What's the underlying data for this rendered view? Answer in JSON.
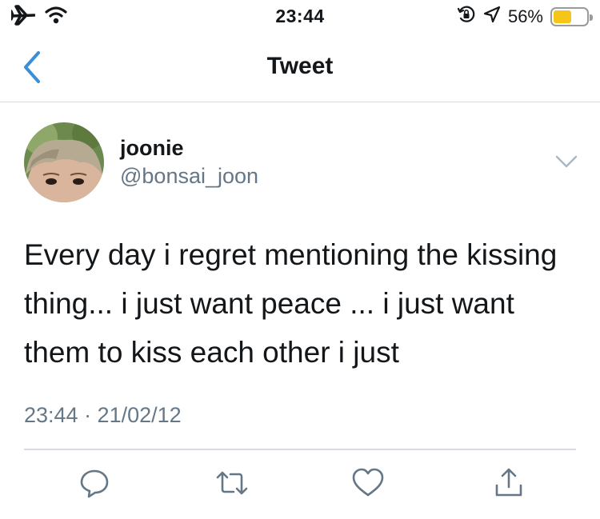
{
  "status_bar": {
    "time": "23:44",
    "battery_percent": "56%",
    "battery_level": 0.56,
    "battery_color": "#f5c518",
    "icons": [
      "airplane-icon",
      "wifi-icon",
      "orientation-lock-icon",
      "location-icon",
      "battery-icon"
    ]
  },
  "nav": {
    "title": "Tweet",
    "back_icon": "chevron-left-icon",
    "accent_color": "#3a8fd8"
  },
  "tweet": {
    "display_name": "joonie",
    "handle": "@bonsai_joon",
    "text": "Every day i regret mentioning the kissing thing... i just want peace ... i just want them to kiss each other i just",
    "timestamp": "23:44 · 21/02/12",
    "actions": [
      "reply-icon",
      "retweet-icon",
      "like-icon",
      "share-icon"
    ],
    "secondary_color": "#657786"
  }
}
